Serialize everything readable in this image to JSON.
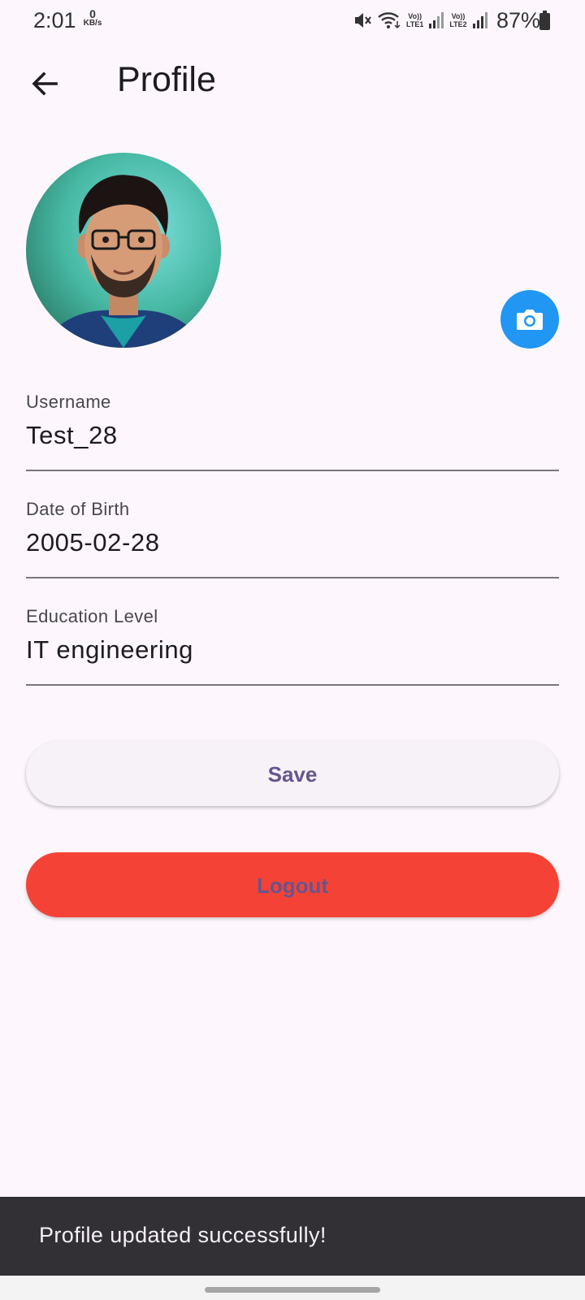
{
  "status_bar": {
    "time": "2:01",
    "net_speed_value": "0",
    "net_speed_unit": "KB/s",
    "sim1_label_top": "Vo))",
    "sim1_label_bottom": "LTE1",
    "sim2_label_top": "Vo))",
    "sim2_label_bottom": "LTE2",
    "battery_percent": "87%",
    "icons": [
      "mute-icon",
      "wifi-icon",
      "signal-icon",
      "signal-icon",
      "battery-icon"
    ]
  },
  "header": {
    "title": "Profile",
    "back_icon": "arrow-back-icon"
  },
  "profile": {
    "avatar": "avatar-image",
    "camera_icon": "camera-icon",
    "camera_button_color": "#2196f3"
  },
  "form": {
    "username": {
      "label": "Username",
      "value": "Test_28"
    },
    "dob": {
      "label": "Date of Birth",
      "value": "2005-02-28"
    },
    "education": {
      "label": "Education Level",
      "value": "IT engineering"
    }
  },
  "actions": {
    "save_label": "Save",
    "logout_label": "Logout",
    "logout_color": "#f44336",
    "label_color": "#65558f"
  },
  "snackbar": {
    "message": "Profile updated successfully!"
  }
}
